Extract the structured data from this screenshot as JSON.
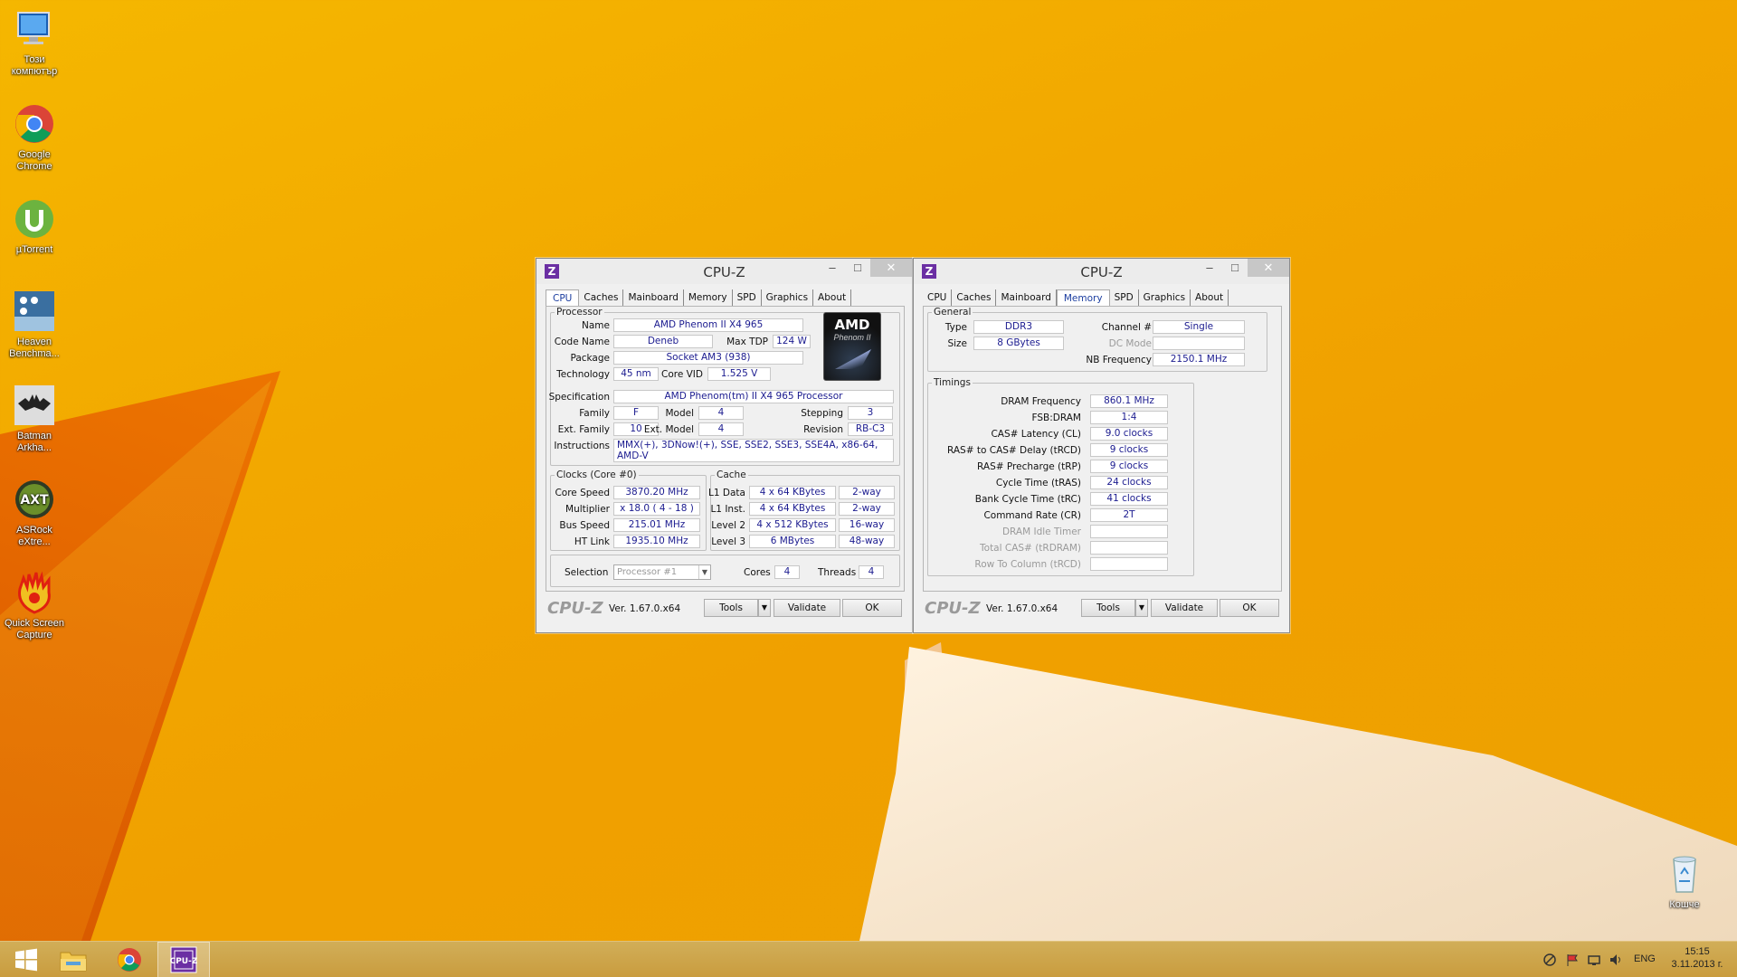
{
  "desktop": {
    "icons": [
      {
        "label": "Този компютър",
        "icon": "computer-icon"
      },
      {
        "label": "Google Chrome",
        "icon": "chrome-icon"
      },
      {
        "label": "µTorrent",
        "icon": "utorrent-icon"
      },
      {
        "label": "Heaven Benchma...",
        "icon": "heaven-benchmark-icon"
      },
      {
        "label": "Batman Arkha...",
        "icon": "batman-icon"
      },
      {
        "label": "ASRock eXtre...",
        "icon": "asrock-icon"
      },
      {
        "label": "Quick Screen Capture",
        "icon": "quick-screen-capture-icon"
      }
    ],
    "recycle_bin": {
      "label": "Кошче",
      "icon": "recycle-bin-icon"
    }
  },
  "window_cpu": {
    "title": "CPU-Z",
    "tabs": [
      "CPU",
      "Caches",
      "Mainboard",
      "Memory",
      "SPD",
      "Graphics",
      "About"
    ],
    "active_tab": "CPU",
    "processor": {
      "legend": "Processor",
      "name_label": "Name",
      "name": "AMD Phenom II X4 965",
      "codename_label": "Code Name",
      "codename": "Deneb",
      "maxtdp_label": "Max TDP",
      "maxtdp": "124 W",
      "package_label": "Package",
      "package": "Socket AM3 (938)",
      "technology_label": "Technology",
      "technology": "45 nm",
      "corevid_label": "Core VID",
      "corevid": "1.525 V",
      "spec_label": "Specification",
      "spec": "AMD Phenom(tm) II X4 965 Processor",
      "family_label": "Family",
      "family": "F",
      "model_label": "Model",
      "model": "4",
      "stepping_label": "Stepping",
      "stepping": "3",
      "extfamily_label": "Ext. Family",
      "extfamily": "10",
      "extmodel_label": "Ext. Model",
      "extmodel": "4",
      "revision_label": "Revision",
      "revision": "RB-C3",
      "instructions_label": "Instructions",
      "instructions": "MMX(+), 3DNow!(+), SSE, SSE2, SSE3, SSE4A, x86-64, AMD-V",
      "logo_brand": "AMD",
      "logo_sub": "Phenom II"
    },
    "clocks": {
      "legend": "Clocks (Core #0)",
      "corespeed_label": "Core Speed",
      "corespeed": "3870.20 MHz",
      "multiplier_label": "Multiplier",
      "multiplier": "x 18.0 ( 4 - 18 )",
      "busspeed_label": "Bus Speed",
      "busspeed": "215.01 MHz",
      "htlink_label": "HT Link",
      "htlink": "1935.10 MHz"
    },
    "cache": {
      "legend": "Cache",
      "l1data_label": "L1 Data",
      "l1data": "4 x 64 KBytes",
      "l1data_way": "2-way",
      "l1inst_label": "L1 Inst.",
      "l1inst": "4 x 64 KBytes",
      "l1inst_way": "2-way",
      "l2_label": "Level 2",
      "l2": "4 x 512 KBytes",
      "l2_way": "16-way",
      "l3_label": "Level 3",
      "l3": "6 MBytes",
      "l3_way": "48-way"
    },
    "selection": {
      "label": "Selection",
      "value": "Processor #1",
      "cores_label": "Cores",
      "cores": "4",
      "threads_label": "Threads",
      "threads": "4"
    },
    "footer": {
      "brand": "CPU-Z",
      "version": "Ver. 1.67.0.x64",
      "tools": "Tools",
      "validate": "Validate",
      "ok": "OK"
    }
  },
  "window_mem": {
    "title": "CPU-Z",
    "tabs": [
      "CPU",
      "Caches",
      "Mainboard",
      "Memory",
      "SPD",
      "Graphics",
      "About"
    ],
    "active_tab": "Memory",
    "general": {
      "legend": "General",
      "type_label": "Type",
      "type": "DDR3",
      "size_label": "Size",
      "size": "8 GBytes",
      "channel_label": "Channel #",
      "channel": "Single",
      "dcmode_label": "DC Mode",
      "dcmode": "",
      "nbfreq_label": "NB Frequency",
      "nbfreq": "2150.1 MHz"
    },
    "timings": {
      "legend": "Timings",
      "rows": [
        {
          "label": "DRAM Frequency",
          "value": "860.1 MHz",
          "dim": false
        },
        {
          "label": "FSB:DRAM",
          "value": "1:4",
          "dim": false
        },
        {
          "label": "CAS# Latency (CL)",
          "value": "9.0 clocks",
          "dim": false
        },
        {
          "label": "RAS# to CAS# Delay (tRCD)",
          "value": "9 clocks",
          "dim": false
        },
        {
          "label": "RAS# Precharge (tRP)",
          "value": "9 clocks",
          "dim": false
        },
        {
          "label": "Cycle Time (tRAS)",
          "value": "24 clocks",
          "dim": false
        },
        {
          "label": "Bank Cycle Time (tRC)",
          "value": "41 clocks",
          "dim": false
        },
        {
          "label": "Command Rate (CR)",
          "value": "2T",
          "dim": false
        },
        {
          "label": "DRAM Idle Timer",
          "value": "",
          "dim": true
        },
        {
          "label": "Total CAS# (tRDRAM)",
          "value": "",
          "dim": true
        },
        {
          "label": "Row To Column (tRCD)",
          "value": "",
          "dim": true
        }
      ]
    },
    "footer": {
      "brand": "CPU-Z",
      "version": "Ver. 1.67.0.x64",
      "tools": "Tools",
      "validate": "Validate",
      "ok": "OK"
    }
  },
  "taskbar": {
    "items": [
      "start-icon",
      "file-explorer-icon",
      "chrome-icon",
      "cpuz-icon"
    ],
    "language": "ENG",
    "time": "15:15",
    "date": "3.11.2013 г."
  },
  "colors": {
    "accent_tab": "#1c3ea0",
    "value_text": "#1b1b8f",
    "cpuz_purple": "#6b2fa3"
  }
}
